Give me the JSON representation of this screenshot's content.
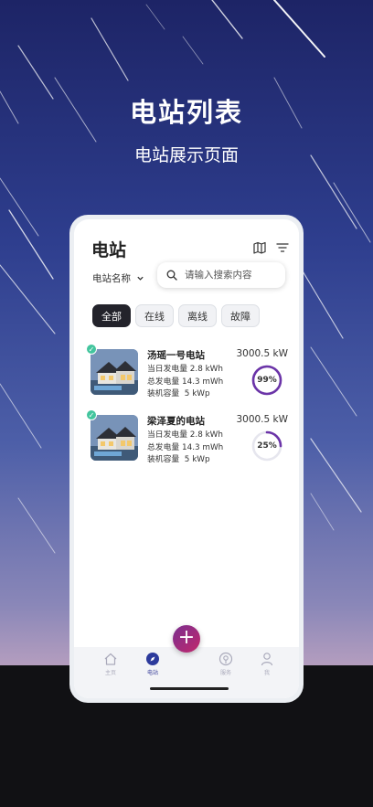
{
  "hero": {
    "title": "电站列表",
    "subtitle": "电站展示页面"
  },
  "app": {
    "title": "电站",
    "name_select": "电站名称",
    "search_placeholder": "请输入搜索内容",
    "tabs": [
      {
        "label": "全部",
        "active": true
      },
      {
        "label": "在线",
        "active": false
      },
      {
        "label": "离线",
        "active": false
      },
      {
        "label": "故障",
        "active": false
      }
    ],
    "stations": [
      {
        "name": "汤瑶一号电站",
        "daily_label": "当日发电量",
        "daily_value": "2.8 kWh",
        "total_label": "总发电量",
        "total_value": "14.3 mWh",
        "capacity_label": "装机容量",
        "capacity_value": "5 kWp",
        "power": "3000.5 kW",
        "percent_text": "99%",
        "percent": 0.99,
        "ring_color": "#6b34a8"
      },
      {
        "name": "梁泽夏的电站",
        "daily_label": "当日发电量",
        "daily_value": "2.8 kWh",
        "total_label": "总发电量",
        "total_value": "14.3 mWh",
        "capacity_label": "装机容量",
        "capacity_value": "5 kWp",
        "power": "3000.5 kW",
        "percent_text": "25%",
        "percent": 0.25,
        "ring_color": "#6b34a8"
      }
    ],
    "nav": [
      {
        "label": "主页",
        "icon": "home-icon",
        "active": false
      },
      {
        "label": "电站",
        "icon": "compass-icon",
        "active": true
      },
      {
        "label": "服务",
        "icon": "service-icon",
        "active": false
      },
      {
        "label": "我",
        "icon": "user-icon",
        "active": false
      }
    ],
    "fab_label": "+"
  },
  "colors": {
    "accent": "#3a3f9a",
    "fab": "#a52a7a",
    "online": "#43c59e"
  }
}
